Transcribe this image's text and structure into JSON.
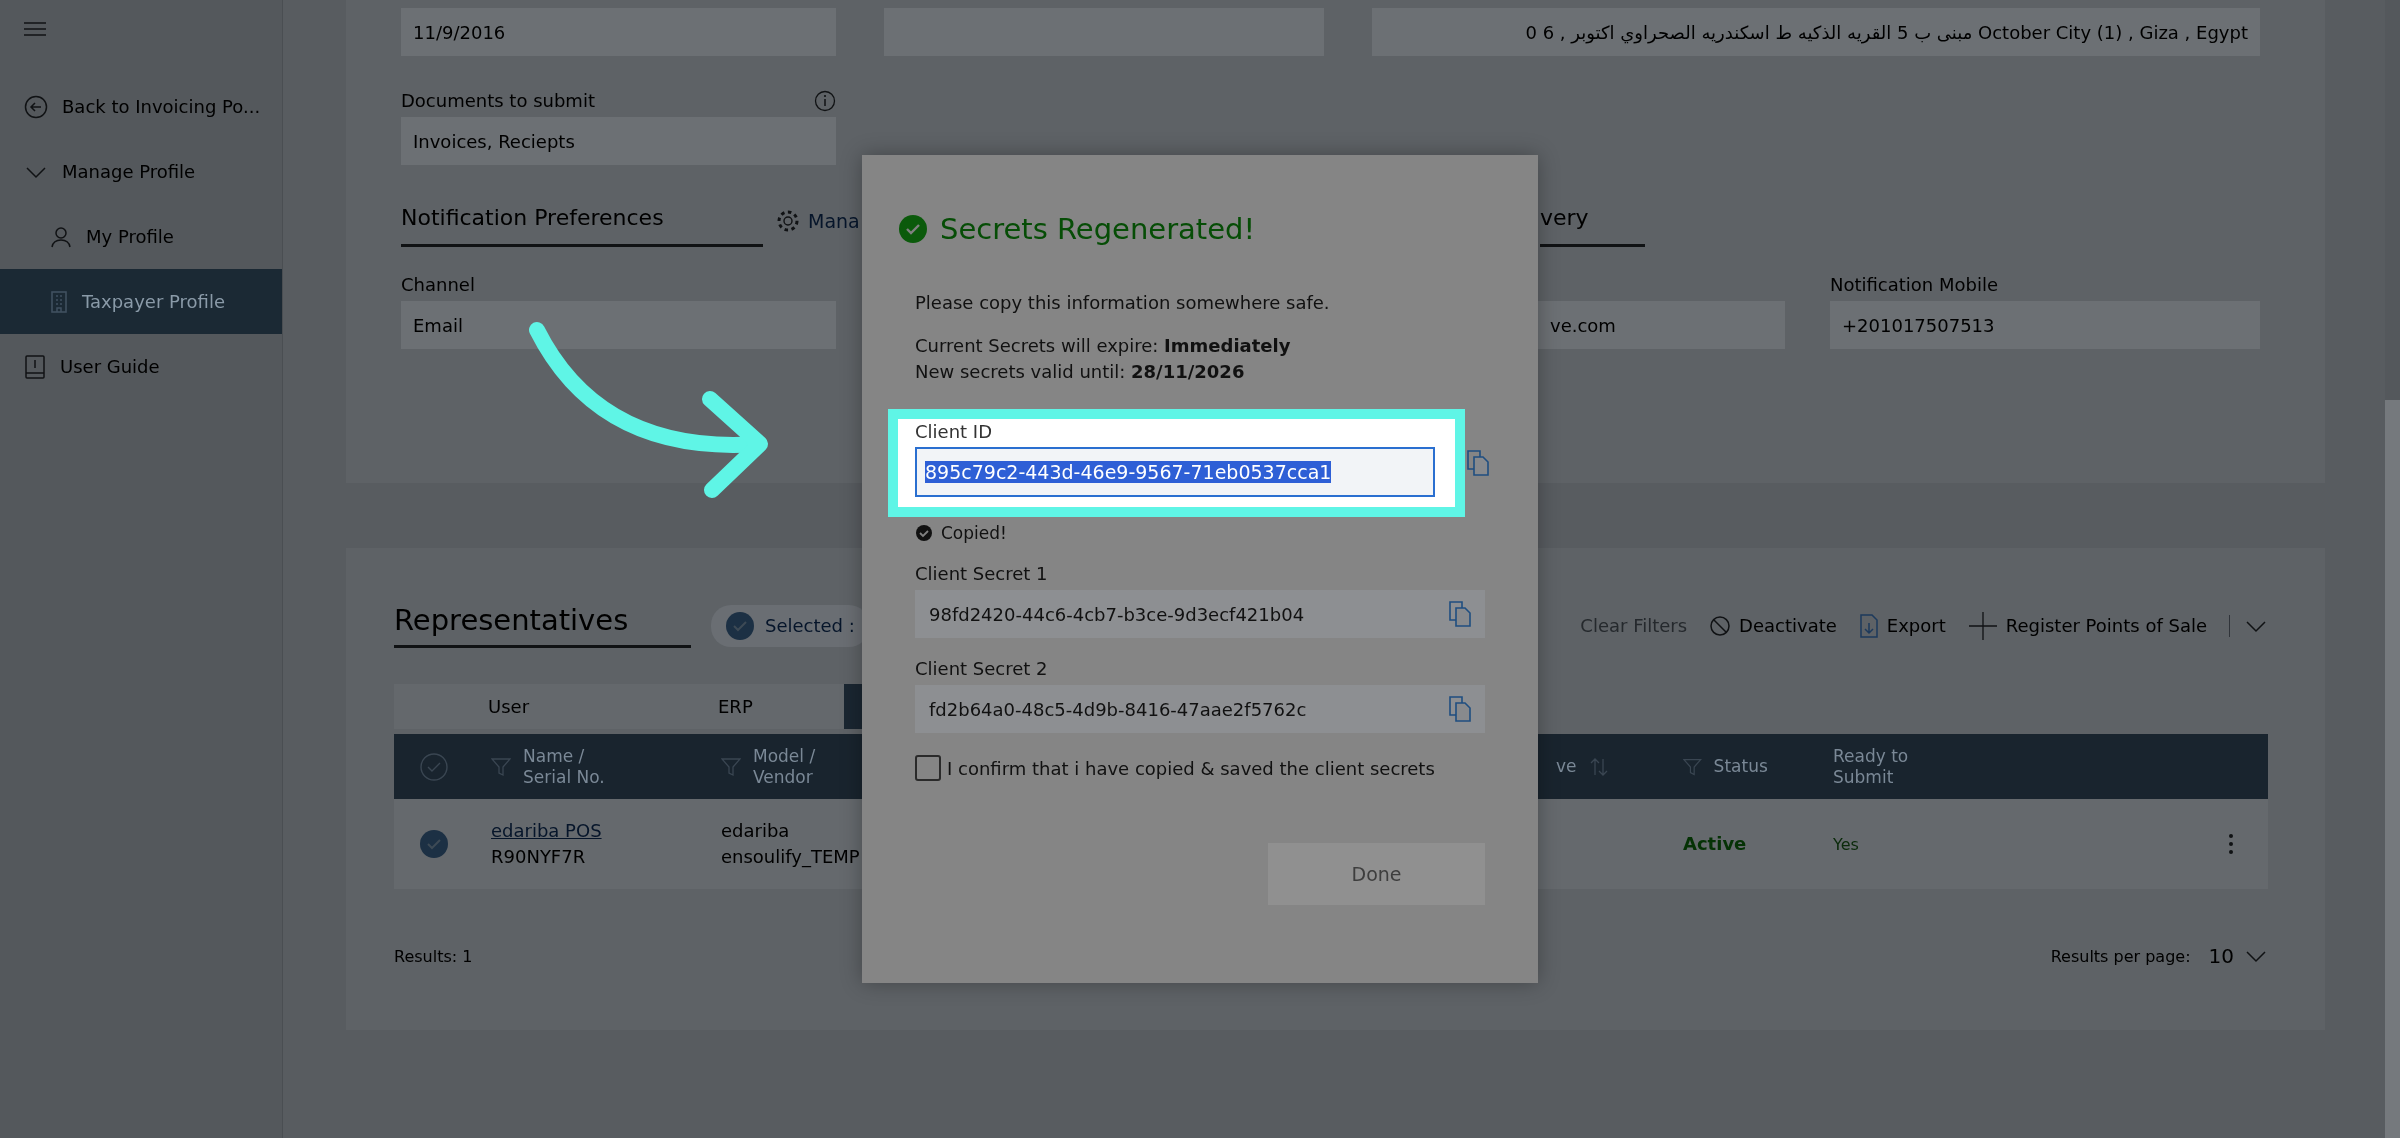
{
  "sidebar": {
    "items": [
      {
        "label": "Back to Invoicing Po...",
        "selected": false
      },
      {
        "label": "Manage Profile",
        "selected": false,
        "expanded": true,
        "children": [
          {
            "label": "My Profile",
            "selected": false
          },
          {
            "label": "Taxpayer Profile",
            "selected": true
          }
        ]
      },
      {
        "label": "User Guide",
        "selected": false
      }
    ]
  },
  "profile": {
    "date_field": {
      "value": "11/9/2016"
    },
    "address_field": {
      "value": "October City (1) , Giza , Egypt مبنى ب 5 القريه الذكيه ط اسكندريه الصحراوي اكتوبر , 6  0"
    },
    "documents": {
      "label": "Documents to submit",
      "value": "Invoices, Reciepts"
    },
    "section_headings": [
      "Notification Preferences",
      "very"
    ],
    "manage_link": "Mana",
    "notification_fields": [
      {
        "label": "Channel",
        "value": "Email"
      },
      {
        "value": "ve.com"
      },
      {
        "label": "Notification Mobile",
        "value": "+201017507513"
      }
    ]
  },
  "representatives": {
    "title": "Representatives",
    "selected_chip": "Selected :",
    "actions": [
      {
        "label": "Clear Filters",
        "disabled": true
      },
      {
        "label": "Deactivate",
        "disabled": false
      },
      {
        "label": "Export",
        "disabled": false
      },
      {
        "label": "Register Points of Sale",
        "disabled": false
      }
    ],
    "view_tabs": [
      {
        "label": "User",
        "selected": false
      },
      {
        "label": "ERP",
        "selected": false
      },
      {
        "selected": true
      }
    ],
    "select_all": {
      "checked": false
    },
    "columns": [
      {
        "label": "Name / Serial No.",
        "kind": "filter"
      },
      {
        "label": "Model / Vendor",
        "kind": "filter"
      },
      {
        "label": "ve",
        "kind": "sort"
      },
      {
        "label": "Status",
        "kind": "filter"
      },
      {
        "label": "Ready to Submit",
        "kind": "plain"
      }
    ],
    "rows": [
      {
        "selected": true,
        "name": "edariba POS",
        "serial": "R90NYF7R",
        "model": "edariba",
        "vendor": "ensoulify_TEMP",
        "status": "Active",
        "ready": "Yes"
      }
    ],
    "results": "Results: 1",
    "per_page_label": "Results per page:",
    "per_page": "10"
  },
  "dialog": {
    "title": "Secrets Regenerated!",
    "intro": "Please copy this information somewhere safe.",
    "expiry": "Current Secrets will expire: **Immediately**",
    "validity": "New secrets valid until: **28/11/2026**",
    "fields": [
      {
        "label": "Client ID",
        "value": "895c79c2-443d-46e9-9567-71eb0537cca1",
        "highlighted": true,
        "status": "Copied!"
      },
      {
        "label": "Client Secret 1",
        "value": "98fd2420-44c6-4cb7-b3ce-9d3ecf421b04",
        "highlighted": false
      },
      {
        "label": "Client Secret 2",
        "value": "fd2b64a0-48c5-4d9b-8416-47aae2f5762c",
        "highlighted": false
      }
    ],
    "confirm": {
      "label": "I confirm that i have copied & saved the client secrets",
      "checked": false
    },
    "done": {
      "label": "Done",
      "disabled": true
    }
  }
}
